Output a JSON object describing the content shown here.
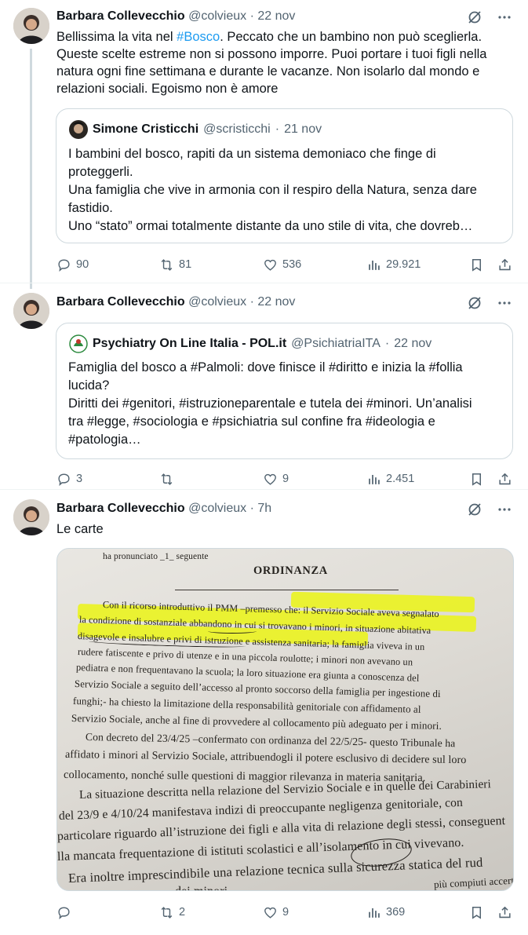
{
  "tweets": [
    {
      "author_name": "Barbara Collevecchio",
      "author_handle": "@colvieux",
      "dot": "·",
      "date": "22 nov",
      "text_parts": [
        "Bellissima la vita nel ",
        "#Bosco",
        ". Peccato che un bambino non può sceglierla."
      ],
      "text_lines": [
        "Queste scelte estreme non si possono imporre. Puoi portare i tuoi figli nella",
        "natura ogni fine settimana e durante le vacanze. Non isolarlo dal mondo e",
        "relazioni sociali. Egoismo non è amore"
      ],
      "quote": {
        "author_name": "Simone Cristicchi",
        "author_handle": "@scristicchi",
        "dot": "·",
        "date": "21 nov",
        "lines": [
          "I bambini del bosco, rapiti da un sistema demoniaco che finge di",
          "proteggerli.",
          "Una famiglia che vive in armonia con il respiro della Natura, senza dare",
          "fastidio.",
          "Uno “stato” ormai totalmente distante da uno stile di vita, che dovreb…"
        ]
      },
      "stats": {
        "replies": "90",
        "reposts": "81",
        "likes": "536",
        "views": "29.921"
      }
    },
    {
      "author_name": "Barbara Collevecchio",
      "author_handle": "@colvieux",
      "dot": "·",
      "date": "22 nov",
      "quote": {
        "author_name": "Psychiatry On Line Italia - POL.it",
        "author_handle": "@PsichiatriaITA",
        "dot": "·",
        "date": "22 nov",
        "lines": [
          "Famiglia del bosco a #Palmoli: dove finisce il #diritto e inizia la #follia",
          "lucida?",
          "Diritti dei #genitori, #istruzioneparentale e tutela dei #minori. Un’analisi",
          "tra #legge, #sociologia e #psichiatria sul confine fra #ideologia e",
          "#patologia…"
        ]
      },
      "stats": {
        "replies": "3",
        "reposts": "",
        "likes": "9",
        "views": "2.451"
      }
    },
    {
      "author_name": "Barbara Collevecchio",
      "author_handle": "@colvieux",
      "dot": "·",
      "date": "7h",
      "text": "Le carte",
      "stats": {
        "replies": "",
        "reposts": "2",
        "likes": "9",
        "views": "369"
      }
    }
  ],
  "document": {
    "lines": [
      "ha pronunciato _1_ seguente",
      "ORDINANZA",
      "Con il ricorso introduttivo il PMM –premesso che: il Servizio Sociale aveva segnalato",
      "la condizione di sostanziale abbandono in cui si trovavano i minori, in situazione abitativa",
      "disagevole e insalubre e privi di istruzione e assistenza sanitaria; la famiglia viveva in un",
      "rudere fatiscente e privo di utenze e in una piccola roulotte; i minori non avevano un",
      "pediatra e non frequentavano la scuola; la loro situazione era giunta a conoscenza del",
      "Servizio Sociale a seguito dell’accesso al pronto soccorso della famiglia per ingestione di",
      "funghi;- ha chiesto la limitazione della responsabilità genitoriale con affidamento al",
      "Servizio Sociale, anche al fine di provvedere al collocamento più adeguato per i minori.",
      "Con decreto del 23/4/25 –confermato con ordinanza del 22/5/25- questo Tribunale ha",
      "affidato i minori al Servizio Sociale, attribuendogli il potere esclusivo di decidere sul loro",
      "collocamento, nonché sulle questioni di maggior rilevanza in materia sanitaria.",
      "La situazione descritta nella relazione del Servizio Sociale e in quelle dei Carabinieri",
      "del 23/9 e 4/10/24 manifestava indizi di preoccupante negligenza genitoriale, con",
      "particolare riguardo all’istruzione dei figli e alla vita di relazione degli stessi, conseguent",
      "lla mancata frequentazione di istituti scolastici e all’isolamento in cui vivevano.",
      "Era inoltre imprescindibile una relazione tecnica sulla sicurezza statica del rud",
      "dei minori.",
      "più compiuti accerta"
    ]
  },
  "colors": {
    "link": "#1d9bf0",
    "muted": "#536471",
    "border": "#cfd9de",
    "highlight": "#ebf514"
  },
  "icons": [
    "grok-icon",
    "more-icon",
    "reply-icon",
    "repost-icon",
    "like-icon",
    "views-icon",
    "bookmark-icon",
    "share-icon"
  ]
}
